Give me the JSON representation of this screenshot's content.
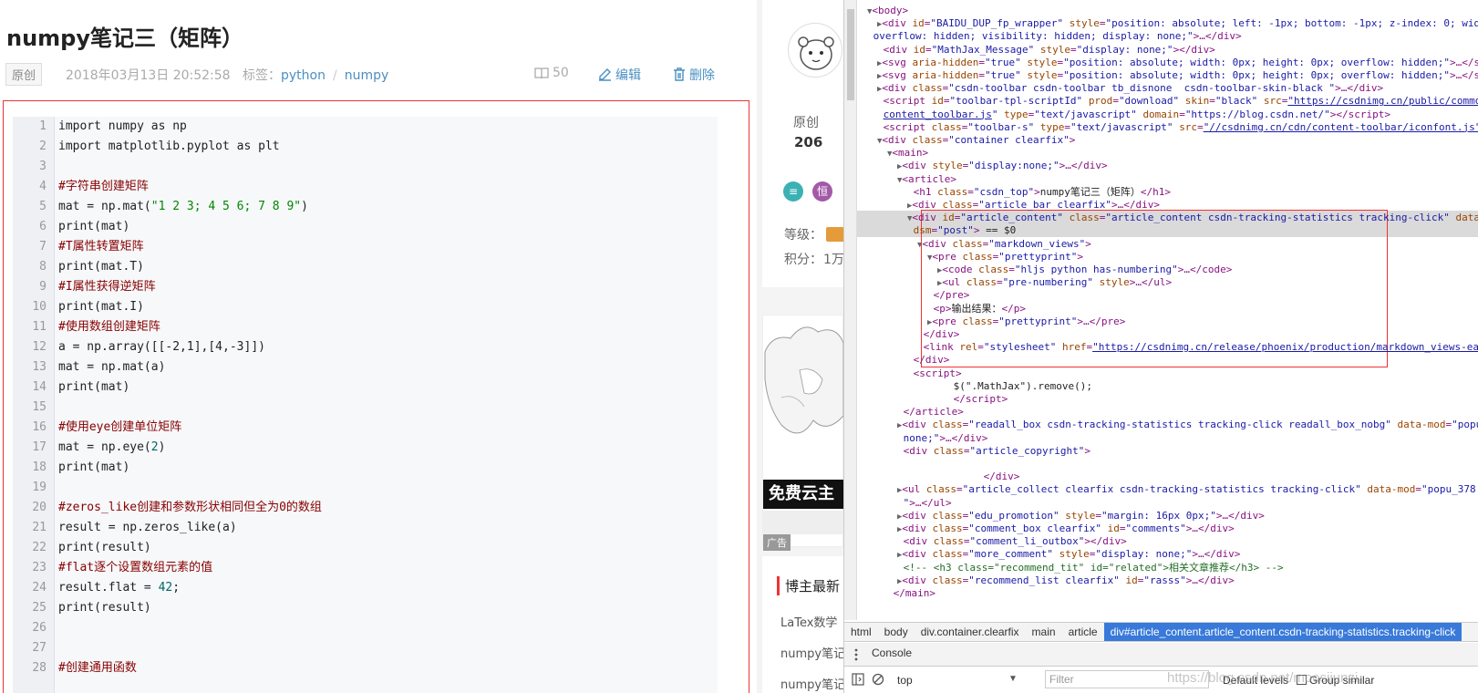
{
  "article": {
    "title": "numpy笔记三（矩阵）",
    "badge": "原创",
    "date": "2018年03月13日 20:52:58",
    "tags_label": "标签：",
    "tags": [
      "python",
      "numpy"
    ],
    "reads": "50",
    "edit": "编辑",
    "delete": "删除"
  },
  "code": {
    "line_numbers": [
      "1",
      "2",
      "3",
      "4",
      "5",
      "6",
      "7",
      "8",
      "9",
      "10",
      "11",
      "12",
      "13",
      "14",
      "15",
      "16",
      "17",
      "18",
      "19",
      "20",
      "21",
      "22",
      "23",
      "24",
      "25",
      "26",
      "27",
      "28"
    ],
    "lines": [
      "import numpy as np",
      "import matplotlib.pyplot as plt",
      "",
      "#字符串创建矩阵",
      "mat = np.mat(\"1 2 3; 4 5 6; 7 8 9\")",
      "print(mat)",
      "#T属性转置矩阵",
      "print(mat.T)",
      "#I属性获得逆矩阵",
      "print(mat.I)",
      "#使用数组创建矩阵",
      "a = np.array([[-2,1],[4,-3]])",
      "mat = np.mat(a)",
      "print(mat)",
      "",
      "#使用eye创建单位矩阵",
      "mat = np.eye(2)",
      "print(mat)",
      "",
      "#zeros_like创建和参数形状相同但全为0的数组",
      "result = np.zeros_like(a)",
      "print(result)",
      "#flat逐个设置数组元素的值",
      "result.flat = 42;",
      "print(result)",
      "",
      "",
      "#创建通用函数"
    ]
  },
  "sidebar": {
    "original_label": "原创",
    "original_count": "206",
    "level_label": "等级：",
    "points_label": "积分：",
    "points_value": "1万",
    "medal1": "≡",
    "medal2": "恒",
    "ad_title": "免费云主",
    "ad_label": "广告",
    "newest_title": "博主最新",
    "newest_items": [
      "LaTex数学",
      "numpy笔记",
      "numpy笔记"
    ]
  },
  "devtools": {
    "tree": [
      {
        "ind": 1,
        "tog": "▼",
        "html": "<span class=t>&lt;body&gt;</span>"
      },
      {
        "ind": 2,
        "tog": "▶",
        "html": "<span class=t>&lt;div</span> <span class=a>id</span>=<span class=v>\"BAIDU_DUP_fp_wrapper\"</span> <span class=a>style</span>=<span class=v>\"position: absolute; left: -1px; bottom: -1px; z-index: 0; width: 0px; height: 0px;</span>"
      },
      {
        "ind": 1,
        "tog": "",
        "html": "<span class=v>overflow: hidden; visibility: hidden; display: none;\"</span><span class=t>&gt;…&lt;/div&gt;</span>"
      },
      {
        "ind": 2,
        "tog": "",
        "html": "<span class=t>&lt;div</span> <span class=a>id</span>=<span class=v>\"MathJax_Message\"</span> <span class=a>style</span>=<span class=v>\"display: none;\"</span><span class=t>&gt;&lt;/div&gt;</span>"
      },
      {
        "ind": 2,
        "tog": "▶",
        "html": "<span class=t>&lt;svg</span> <span class=a>aria-hidden</span>=<span class=v>\"true\"</span> <span class=a>style</span>=<span class=v>\"position: absolute; width: 0px; height: 0px; overflow: hidden;\"</span><span class=t>&gt;…&lt;/svg&gt;</span>"
      },
      {
        "ind": 2,
        "tog": "▶",
        "html": "<span class=t>&lt;svg</span> <span class=a>aria-hidden</span>=<span class=v>\"true\"</span> <span class=a>style</span>=<span class=v>\"position: absolute; width: 0px; height: 0px; overflow: hidden;\"</span><span class=t>&gt;…&lt;/svg&gt;</span>"
      },
      {
        "ind": 2,
        "tog": "▶",
        "html": "<span class=t>&lt;div</span> <span class=a>class</span>=<span class=v>\"csdn-toolbar csdn-toolbar tb_disnone  csdn-toolbar-skin-black \"</span><span class=t>&gt;…&lt;/div&gt;</span>"
      },
      {
        "ind": 2,
        "tog": "",
        "html": "<span class=t>&lt;script</span> <span class=a>id</span>=<span class=v>\"toolbar-tpl-scriptId\"</span> <span class=a>prod</span>=<span class=v>\"download\"</span> <span class=a>skin</span>=<span class=v>\"black\"</span> <span class=a>src</span>=<span class=u>\"https://csdnimg.cn/public/common/toolbar/js/</span>"
      },
      {
        "ind": 2,
        "tog": "",
        "html": "<span class=u>content_toolbar.js</span><span class=v>\"</span> <span class=a>type</span>=<span class=v>\"text/javascript\"</span> <span class=a>domain</span>=<span class=v>\"https://blog.csdn.net/\"</span><span class=t>&gt;&lt;/script&gt;</span>"
      },
      {
        "ind": 2,
        "tog": "",
        "html": "<span class=t>&lt;script</span> <span class=a>class</span>=<span class=v>\"toolbar-s\"</span> <span class=a>type</span>=<span class=v>\"text/javascript\"</span> <span class=a>src</span>=<span class=u>\"//csdnimg.cn/cdn/content-toolbar/iconfont.js\"</span>"
      },
      {
        "ind": 2,
        "tog": "▼",
        "html": "<span class=t>&lt;div</span> <span class=a>class</span>=<span class=v>\"container clearfix\"</span><span class=t>&gt;</span>"
      },
      {
        "ind": 3,
        "tog": "▼",
        "html": "<span class=t>&lt;main&gt;</span>"
      },
      {
        "ind": 4,
        "tog": "▶",
        "html": "<span class=t>&lt;div</span> <span class=a>style</span>=<span class=v>\"display:none;\"</span><span class=t>&gt;…&lt;/div&gt;</span>"
      },
      {
        "ind": 4,
        "tog": "▼",
        "html": "<span class=t>&lt;article&gt;</span>"
      },
      {
        "ind": 5,
        "tog": "",
        "html": "<span class=t>&lt;h1</span> <span class=a>class</span>=<span class=v>\"csdn_top\"</span><span class=t>&gt;</span><span class=x>numpy笔记三（矩阵）</span><span class=t>&lt;/h1&gt;</span>"
      },
      {
        "ind": 5,
        "tog": "▶",
        "html": "<span class=t>&lt;div</span> <span class=a>class</span>=<span class=v>\"article_bar clearfix\"</span><span class=t>&gt;…&lt;/div&gt;</span>"
      },
      {
        "ind": 5,
        "tog": "▼",
        "html": "<span class=t>&lt;div</span> <span class=a>id</span>=<span class=v>\"article_content\"</span> <span class=a>class</span>=<span class=v>\"article_content csdn-tracking-statistics tracking-click\"</span> <span class=a>data-mod</span>=<span class=v>\"popu_519\"</span> <span class=a>data-</span>"
      },
      {
        "ind": 5,
        "tog": "",
        "html": "<span class=a>dsm</span>=<span class=v>\"post\"</span><span class=t>&gt;</span> <span class=x>== $0</span>"
      },
      {
        "ind": 6,
        "tog": "▼",
        "html": "<span class=t>&lt;div</span> <span class=a>class</span>=<span class=v>\"markdown_views\"</span><span class=t>&gt;</span>"
      },
      {
        "ind": 7,
        "tog": "▼",
        "html": "<span class=t>&lt;pre</span> <span class=a>class</span>=<span class=v>\"prettyprint\"</span><span class=t>&gt;</span>"
      },
      {
        "ind": 8,
        "tog": "▶",
        "html": "<span class=t>&lt;code</span> <span class=a>class</span>=<span class=v>\"hljs python has-numbering\"</span><span class=t>&gt;…&lt;/code&gt;</span>"
      },
      {
        "ind": 8,
        "tog": "▶",
        "html": "<span class=t>&lt;ul</span> <span class=a>class</span>=<span class=v>\"pre-numbering\"</span> <span class=a>style</span><span class=t>&gt;…&lt;/ul&gt;</span>"
      },
      {
        "ind": 7,
        "tog": "",
        "html": "<span class=t>&lt;/pre&gt;</span>"
      },
      {
        "ind": 7,
        "tog": "",
        "html": "<span class=t>&lt;p&gt;</span><span class=x>输出结果：</span><span class=t>&lt;/p&gt;</span>"
      },
      {
        "ind": 7,
        "tog": "▶",
        "html": "<span class=t>&lt;pre</span> <span class=a>class</span>=<span class=v>\"prettyprint\"</span><span class=t>&gt;…&lt;/pre&gt;</span>"
      },
      {
        "ind": 6,
        "tog": "",
        "html": "<span class=t>&lt;/div&gt;</span>"
      },
      {
        "ind": 6,
        "tog": "",
        "html": "<span class=t>&lt;link</span> <span class=a>rel</span>=<span class=v>\"stylesheet\"</span> <span class=a>href</span>=<span class=u>\"https://csdnimg.cn/release/phoenix/production/markdown_views-ea0013b516.css\"</span>"
      },
      {
        "ind": 5,
        "tog": "",
        "html": "<span class=t>&lt;/div&gt;</span>"
      },
      {
        "ind": 5,
        "tog": "",
        "html": "<span class=t>&lt;script&gt;</span>"
      },
      {
        "ind": 9,
        "tog": "",
        "html": "<span class=x>$(\".MathJax\").remove();</span>"
      },
      {
        "ind": 9,
        "tog": "",
        "html": "<span class=t>&lt;/script&gt;</span>"
      },
      {
        "ind": 4,
        "tog": "",
        "html": "<span class=t>&lt;/article&gt;</span>"
      },
      {
        "ind": 4,
        "tog": "▶",
        "html": "<span class=t>&lt;div</span> <span class=a>class</span>=<span class=v>\"readall_box csdn-tracking-statistics tracking-click readall_box_nobg\"</span> <span class=a>data-mod</span>=<span class=v>\"popu_376\"</span> <span class=a>style</span>=<span class=v>\"display:</span>"
      },
      {
        "ind": 4,
        "tog": "",
        "html": "<span class=v>none;\"</span><span class=t>&gt;…&lt;/div&gt;</span>"
      },
      {
        "ind": 4,
        "tog": "",
        "html": "<span class=t>&lt;div</span> <span class=a>class</span>=<span class=v>\"article_copyright\"</span><span class=t>&gt;</span>"
      },
      {
        "ind": 4,
        "tog": "",
        "html": ""
      },
      {
        "ind": 12,
        "tog": "",
        "html": "<span class=t>&lt;/div&gt;</span>"
      },
      {
        "ind": 4,
        "tog": "▶",
        "html": "<span class=t>&lt;ul</span> <span class=a>class</span>=<span class=v>\"article_collect clearfix csdn-tracking-statistics tracking-click\"</span> <span class=a>data-mod</span>=<span class=v>\"popu_378</span>"
      },
      {
        "ind": 4,
        "tog": "",
        "html": "<span class=v>\"</span><span class=t>&gt;…&lt;/ul&gt;</span>"
      },
      {
        "ind": 4,
        "tog": "▶",
        "html": "<span class=t>&lt;div</span> <span class=a>class</span>=<span class=v>\"edu_promotion\"</span> <span class=a>style</span>=<span class=v>\"margin: 16px 0px;\"</span><span class=t>&gt;…&lt;/div&gt;</span>"
      },
      {
        "ind": 4,
        "tog": "▶",
        "html": "<span class=t>&lt;div</span> <span class=a>class</span>=<span class=v>\"comment_box clearfix\"</span> <span class=a>id</span>=<span class=v>\"comments\"</span><span class=t>&gt;…&lt;/div&gt;</span>"
      },
      {
        "ind": 4,
        "tog": "",
        "html": "<span class=t>&lt;div</span> <span class=a>class</span>=<span class=v>\"comment_li_outbox\"</span><span class=t>&gt;&lt;/div&gt;</span>"
      },
      {
        "ind": 4,
        "tog": "▶",
        "html": "<span class=t>&lt;div</span> <span class=a>class</span>=<span class=v>\"more_comment\"</span> <span class=a>style</span>=<span class=v>\"display: none;\"</span><span class=t>&gt;…&lt;/div&gt;</span>"
      },
      {
        "ind": 4,
        "tog": "",
        "html": "<span class=c>&lt;!-- &lt;h3 class=\"recommend_tit\" id=\"related\"&gt;相关文章推荐&lt;/h3&gt; --&gt;</span>"
      },
      {
        "ind": 4,
        "tog": "▶",
        "html": "<span class=t>&lt;div</span> <span class=a>class</span>=<span class=v>\"recommend_list clearfix\"</span> <span class=a>id</span>=<span class=v>\"rasss\"</span><span class=t>&gt;…&lt;/div&gt;</span>"
      },
      {
        "ind": 3,
        "tog": "",
        "html": "<span class=t>&lt;/main&gt;</span>"
      }
    ],
    "selected_index": 16,
    "breadcrumbs": [
      "html",
      "body",
      "div.container.clearfix",
      "main",
      "article",
      "div#article_content.article_content.csdn-tracking-statistics.tracking-click"
    ],
    "console_tab": "Console",
    "context": "top",
    "filter_placeholder": "Filter",
    "levels": "Default levels",
    "group_similar": "Group similar"
  },
  "watermark": "https://blog.csdn.net/moosijunzi"
}
